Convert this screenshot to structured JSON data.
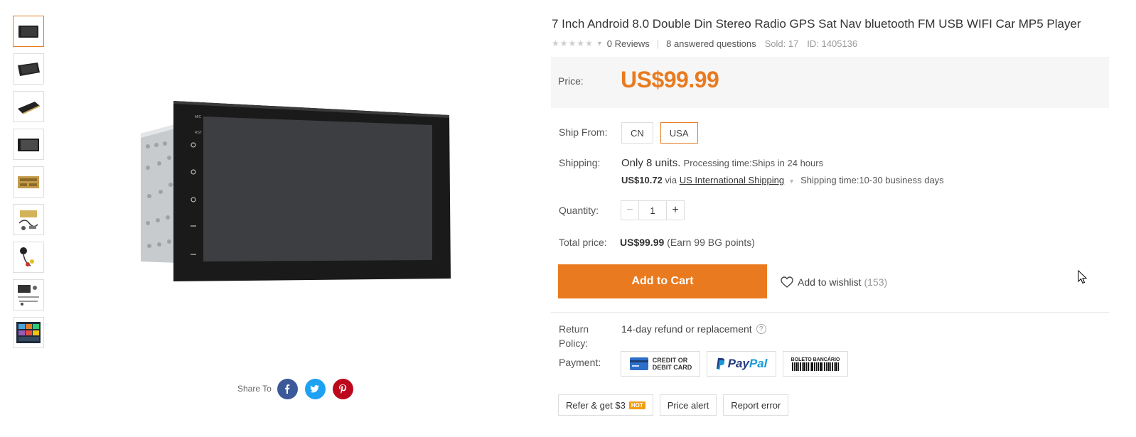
{
  "thumbnails": [
    {
      "icon": "head-unit-front-thumb"
    },
    {
      "icon": "head-unit-angle-thumb"
    },
    {
      "icon": "head-unit-side-thumb"
    },
    {
      "icon": "head-unit-screen-thumb"
    },
    {
      "icon": "head-unit-back-panel-thumb"
    },
    {
      "icon": "accessories-thumb"
    },
    {
      "icon": "camera-cable-thumb"
    },
    {
      "icon": "package-contents-thumb"
    },
    {
      "icon": "app-screens-thumb"
    }
  ],
  "share": {
    "label": "Share To",
    "buttons": [
      {
        "name": "facebook",
        "color": "#3b5998"
      },
      {
        "name": "twitter",
        "color": "#1da1f2"
      },
      {
        "name": "pinterest",
        "color": "#bd081c"
      }
    ]
  },
  "product": {
    "title": "7 Inch Android 8.0 Double Din Stereo Radio GPS Sat Nav bluetooth FM USB WIFI Car MP5 Player",
    "reviews": "0 Reviews",
    "questions": "8 answered questions",
    "sold": "Sold: 17",
    "id": "ID: 1405136"
  },
  "price": {
    "label": "Price:",
    "value": "US$99.99",
    "color": "#e97a1f"
  },
  "ship_from": {
    "label": "Ship From:",
    "options": [
      "CN",
      "USA"
    ],
    "selected": "USA"
  },
  "shipping": {
    "label": "Shipping:",
    "stock": "Only 8 units.",
    "processing": "Processing time:Ships in 24 hours",
    "cost": "US$10.72",
    "via": "via",
    "method": "US International Shipping",
    "time": "Shipping time:10-30 business days"
  },
  "quantity": {
    "label": "Quantity:",
    "value": "1",
    "minus": "−",
    "plus": "+"
  },
  "total": {
    "label": "Total price:",
    "value": "US$99.99",
    "points": "(Earn 99 BG points)"
  },
  "actions": {
    "add_to_cart": "Add to Cart",
    "wishlist": "Add to wishlist",
    "wishlist_count": "(153)"
  },
  "return_policy": {
    "label": "Return Policy:",
    "value": "14-day refund or replacement",
    "help": "?"
  },
  "payment": {
    "label": "Payment:",
    "card_line1": "CREDIT OR",
    "card_line2": "DEBIT CARD",
    "paypal_a": "Pay",
    "paypal_b": "Pal",
    "boleto": "BOLETO BANCÁRIO"
  },
  "tools": {
    "refer": "Refer & get $3",
    "hot": "HOT",
    "price_alert": "Price alert",
    "report": "Report error"
  }
}
